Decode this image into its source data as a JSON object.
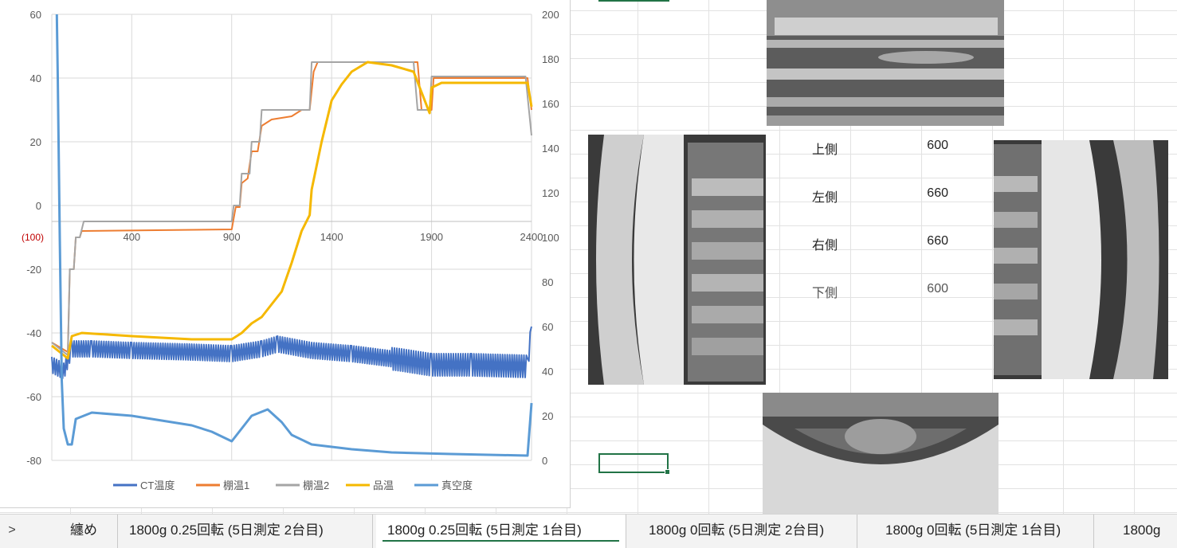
{
  "chart_data": {
    "type": "line",
    "left_axis": {
      "min": -80,
      "max": 60,
      "ticks": [
        60,
        40,
        20,
        0,
        -20,
        -40,
        -60,
        -80
      ]
    },
    "right_axis": {
      "min": 0,
      "max": 200,
      "ticks": [
        200,
        180,
        160,
        140,
        120,
        100,
        80,
        60,
        40,
        20,
        0
      ]
    },
    "x_axis": {
      "min": 0,
      "max": 2400,
      "ticks": [
        400,
        900,
        1400,
        1900,
        2400
      ],
      "crosses_at": -5,
      "origin_label": "(100)"
    },
    "legend_position": "bottom",
    "series": [
      {
        "name": "CT温度",
        "color": "#4472C4",
        "axis": "left",
        "points": [
          [
            0,
            -50
          ],
          [
            60,
            -52
          ],
          [
            100,
            -45
          ],
          [
            200,
            -45
          ],
          [
            400,
            -45.5
          ],
          [
            700,
            -46
          ],
          [
            900,
            -46.5
          ],
          [
            1050,
            -45
          ],
          [
            1130,
            -43.5
          ],
          [
            1300,
            -45.5
          ],
          [
            1500,
            -46.5
          ],
          [
            1750,
            -48.5
          ],
          [
            1900,
            -50
          ],
          [
            2100,
            -50
          ],
          [
            2380,
            -50.5
          ],
          [
            2400,
            -38
          ]
        ],
        "noise": 2.5
      },
      {
        "name": "棚温1",
        "color": "#ED7D31",
        "axis": "left",
        "points": [
          [
            0,
            -43
          ],
          [
            80,
            -46
          ],
          [
            90,
            -20
          ],
          [
            110,
            -20
          ],
          [
            120,
            -10
          ],
          [
            140,
            -10
          ],
          [
            150,
            -8
          ],
          [
            900,
            -7.5
          ],
          [
            920,
            -0.5
          ],
          [
            940,
            -0.5
          ],
          [
            950,
            7
          ],
          [
            980,
            8.5
          ],
          [
            1000,
            17
          ],
          [
            1030,
            17
          ],
          [
            1050,
            25
          ],
          [
            1100,
            27
          ],
          [
            1200,
            28
          ],
          [
            1250,
            30
          ],
          [
            1290,
            30
          ],
          [
            1310,
            42
          ],
          [
            1330,
            45
          ],
          [
            1830,
            45
          ],
          [
            1850,
            30
          ],
          [
            1900,
            30
          ],
          [
            1910,
            40
          ],
          [
            2380,
            40
          ],
          [
            2400,
            30
          ]
        ]
      },
      {
        "name": "棚温2",
        "color": "#A5A5A5",
        "axis": "left",
        "points": [
          [
            0,
            -43
          ],
          [
            80,
            -47
          ],
          [
            90,
            -20
          ],
          [
            110,
            -20
          ],
          [
            120,
            -10
          ],
          [
            140,
            -10
          ],
          [
            160,
            -5
          ],
          [
            900,
            -5
          ],
          [
            910,
            0
          ],
          [
            940,
            0
          ],
          [
            950,
            10
          ],
          [
            990,
            10
          ],
          [
            1000,
            20
          ],
          [
            1040,
            20
          ],
          [
            1050,
            30
          ],
          [
            1290,
            30
          ],
          [
            1300,
            45
          ],
          [
            1810,
            45
          ],
          [
            1830,
            30
          ],
          [
            1890,
            30
          ],
          [
            1900,
            40.5
          ],
          [
            2370,
            40.5
          ],
          [
            2400,
            22
          ]
        ]
      },
      {
        "name": "品温",
        "color": "#F5B800",
        "axis": "left",
        "points": [
          [
            0,
            -44
          ],
          [
            80,
            -48
          ],
          [
            100,
            -41
          ],
          [
            150,
            -40
          ],
          [
            400,
            -41
          ],
          [
            700,
            -42
          ],
          [
            900,
            -42
          ],
          [
            950,
            -40
          ],
          [
            1000,
            -37
          ],
          [
            1050,
            -35
          ],
          [
            1100,
            -31
          ],
          [
            1150,
            -27
          ],
          [
            1200,
            -18
          ],
          [
            1250,
            -8
          ],
          [
            1290,
            -3
          ],
          [
            1300,
            5
          ],
          [
            1350,
            20
          ],
          [
            1400,
            33
          ],
          [
            1450,
            38
          ],
          [
            1500,
            42
          ],
          [
            1580,
            45
          ],
          [
            1700,
            44
          ],
          [
            1810,
            42
          ],
          [
            1890,
            29
          ],
          [
            1900,
            37
          ],
          [
            1950,
            38.5
          ],
          [
            2380,
            38.5
          ],
          [
            2400,
            31
          ]
        ]
      },
      {
        "name": "真空度",
        "color": "#5B9BD5",
        "axis": "left",
        "points": [
          [
            25,
            60
          ],
          [
            30,
            40
          ],
          [
            40,
            -10
          ],
          [
            50,
            -55
          ],
          [
            60,
            -70
          ],
          [
            80,
            -75
          ],
          [
            100,
            -75
          ],
          [
            120,
            -67
          ],
          [
            200,
            -65
          ],
          [
            400,
            -66
          ],
          [
            700,
            -69
          ],
          [
            800,
            -71
          ],
          [
            900,
            -74
          ],
          [
            950,
            -70
          ],
          [
            1000,
            -66
          ],
          [
            1080,
            -64
          ],
          [
            1150,
            -68
          ],
          [
            1200,
            -72
          ],
          [
            1300,
            -75
          ],
          [
            1500,
            -76.5
          ],
          [
            1700,
            -77.5
          ],
          [
            2000,
            -78
          ],
          [
            2380,
            -78.5
          ],
          [
            2400,
            -62
          ]
        ]
      }
    ]
  },
  "measurements": [
    {
      "label": "上側",
      "value": "600"
    },
    {
      "label": "左側",
      "value": "660"
    },
    {
      "label": "右側",
      "value": "660"
    },
    {
      "label": "下側",
      "value": "600"
    }
  ],
  "tabs": [
    {
      "label": ">",
      "active": false
    },
    {
      "label": "纏め",
      "active": false
    },
    {
      "label": "1800g  0.25回転 (5日測定 2台目)",
      "active": false
    },
    {
      "label": "1800g  0.25回転 (5日測定 1台目)",
      "active": true
    },
    {
      "label": "1800g  0回転 (5日測定 2台目)",
      "active": false
    },
    {
      "label": "1800g  0回転 (5日測定 1台目)",
      "active": false
    },
    {
      "label": "1800g",
      "active": false
    }
  ],
  "colors": {
    "accent": "#217346",
    "origin_label_color": "#C00000"
  }
}
